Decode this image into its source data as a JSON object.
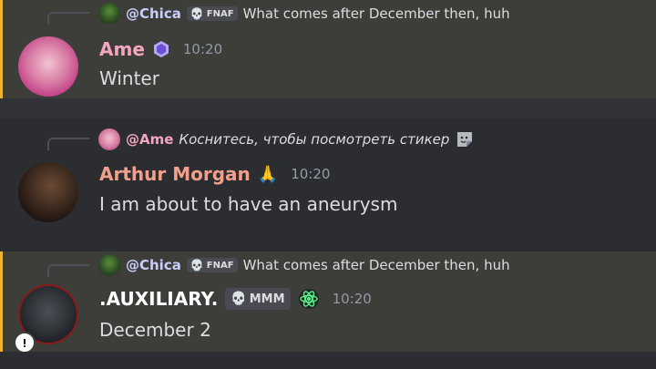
{
  "colors": {
    "accent_bar": "#f0b232",
    "username_ame": "#f4a6c0",
    "username_arthur": "#f2a08c",
    "username_auxiliary": "#ffffff",
    "timestamp": "#949ba4"
  },
  "messages": [
    {
      "reply": {
        "mention": "@Chica",
        "tag": "FNAF",
        "text": "What comes after December then, huh"
      },
      "username": "Ame",
      "badge_icon": "purple-hexagon-icon",
      "time": "10:20",
      "content": "Winter"
    },
    {
      "reply": {
        "mention": "@Ame",
        "text": "Коснитесь, чтобы посмотреть стикер",
        "icon": "sticker-icon"
      },
      "username": "Arthur Morgan",
      "badge_icon": "praying-hands-icon",
      "time": "10:20",
      "content": "I am about to have an aneurysm"
    },
    {
      "reply": {
        "mention": "@Chica",
        "tag": "FNAF",
        "text": "What comes after December then, huh"
      },
      "username": ".AUXILIARY.",
      "tag": "MMM",
      "badge_icon": "atom-icon",
      "time": "10:20",
      "content": "December 2"
    }
  ]
}
